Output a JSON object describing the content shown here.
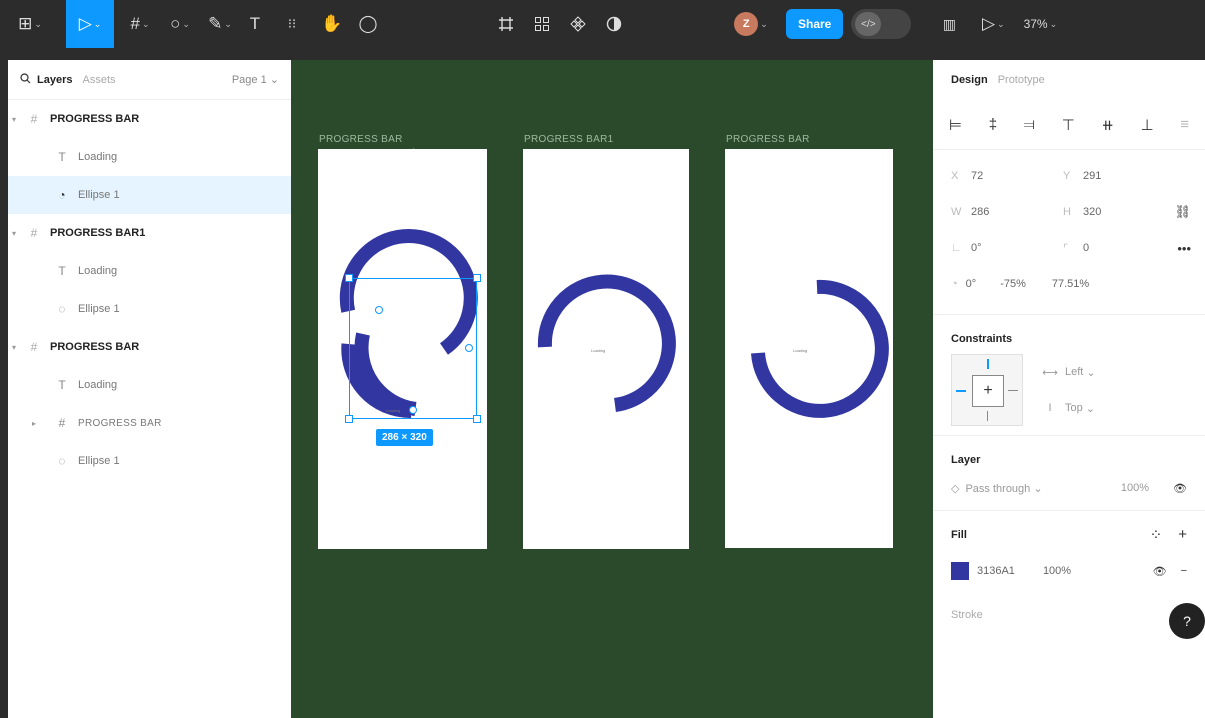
{
  "toolbar": {
    "main_menu_icon": "⊞",
    "move_tool_icon": "▷",
    "frame_tool_icon": "#",
    "shape_tool_icon": "○",
    "pen_tool_icon": "✎",
    "text_tool_icon": "T",
    "resources_icon": "⁝⁝",
    "hand_tool_icon": "✋",
    "comment_tool_icon": "◯",
    "avatar_initial": "Z",
    "share_label": "Share",
    "dev_mode_icon": "</>",
    "library_icon": "▥",
    "present_icon": "▷",
    "zoom_label": "37%"
  },
  "left_panel": {
    "search_icon": "🔍",
    "tab_layers": "Layers",
    "tab_assets": "Assets",
    "page_label": "Page 1",
    "layers": [
      {
        "label": "PROGRESS BAR",
        "type": "frame"
      },
      {
        "label": "Loading",
        "type": "text"
      },
      {
        "label": "Ellipse 1",
        "type": "ellipse",
        "selected": true
      },
      {
        "label": "PROGRESS BAR1",
        "type": "frame"
      },
      {
        "label": "Loading",
        "type": "text"
      },
      {
        "label": "Ellipse 1",
        "type": "ellipse"
      },
      {
        "label": "PROGRESS BAR",
        "type": "frame"
      },
      {
        "label": "Loading",
        "type": "text"
      },
      {
        "label": "PROGRESS BAR",
        "type": "frame-nested"
      },
      {
        "label": "Ellipse 1",
        "type": "ellipse"
      }
    ]
  },
  "canvas": {
    "frames": [
      {
        "label": "PROGRESS BAR",
        "loading": "Loading"
      },
      {
        "label": "PROGRESS BAR1",
        "loading": "Loading"
      },
      {
        "label": "PROGRESS BAR",
        "loading": "Loading"
      }
    ],
    "dimension_badge": "286 × 320",
    "arc_color": "#3136A1"
  },
  "right_panel": {
    "tab_design": "Design",
    "tab_prototype": "Prototype",
    "props": {
      "x_label": "X",
      "x": "72",
      "y_label": "Y",
      "y": "291",
      "w_label": "W",
      "w": "286",
      "h_label": "H",
      "h": "320",
      "rotation": "0°",
      "radius": "0",
      "arc_start": "0°",
      "arc_sweep": "-75%",
      "arc_ratio": "77.51%"
    },
    "constraints": {
      "title": "Constraints",
      "horizontal": "Left",
      "vertical": "Top"
    },
    "layer": {
      "title": "Layer",
      "blend": "Pass through",
      "opacity": "100%"
    },
    "fill": {
      "title": "Fill",
      "hex": "3136A1",
      "opacity": "100%",
      "color": "#3136A1"
    },
    "stroke_title": "Stroke",
    "help_label": "?"
  }
}
